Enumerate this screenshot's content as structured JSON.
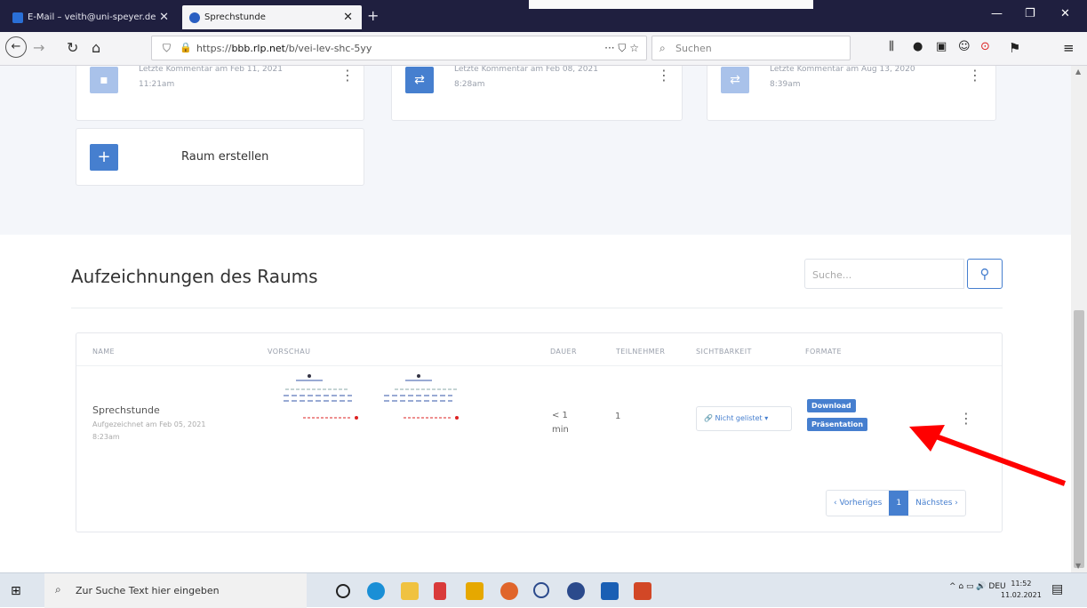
{
  "browser": {
    "tabs": [
      {
        "label": "E-Mail – veith@uni-speyer.de",
        "active": false
      },
      {
        "label": "Sprechstunde",
        "active": true
      }
    ],
    "url_prefix": "https://",
    "url_domain": "bbb.rlp.net",
    "url_path": "/b/vei-lev-shc-5yy",
    "search_placeholder": "Suchen",
    "page_actions": "··· ⛉ ☆"
  },
  "rooms": {
    "cards": [
      {
        "meta1": "Letzte Kommentar am Feb 11, 2021",
        "meta2": "11:21am"
      },
      {
        "meta1": "Letzte Kommentar am Feb 08, 2021",
        "meta2": "8:28am"
      },
      {
        "meta1": "Letzte Kommentar am Aug 13, 2020",
        "meta2": "8:39am"
      }
    ],
    "create_label": "Raum erstellen"
  },
  "recordings": {
    "title": "Aufzeichnungen des Raums",
    "search_placeholder": "Suche...",
    "columns": [
      "NAME",
      "VORSCHAU",
      "DAUER",
      "TEILNEHMER",
      "SICHTBARKEIT",
      "FORMATE"
    ],
    "rows": [
      {
        "name": "Sprechstunde",
        "recorded": "Aufgezeichnet am Feb 05, 2021",
        "time": "8:23am",
        "duration_1": "< 1",
        "duration_2": "min",
        "participants": "1",
        "visibility": "Nicht gelistet",
        "format_1": "Download",
        "format_2": "Präsentation"
      }
    ],
    "pager": {
      "prev": "‹ Vorheriges",
      "current": "1",
      "next": "Nächstes ›"
    }
  },
  "taskbar": {
    "search_placeholder": "Zur Suche Text hier eingeben",
    "tray_lang": "DEU",
    "time": "11:52",
    "date": "11.02.2021"
  },
  "colors": {
    "accent": "#467fcf",
    "arrow": "#ff0000",
    "tabbar": "#1f1f3f"
  }
}
